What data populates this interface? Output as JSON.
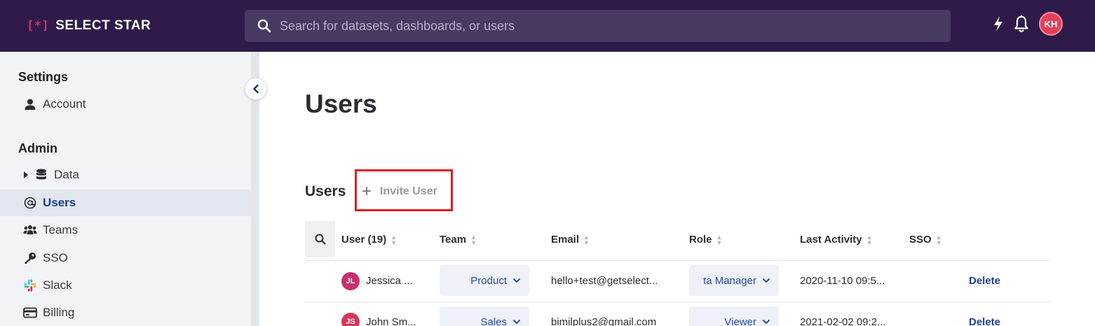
{
  "brand": {
    "name": "SELECT STAR",
    "mark": "[*]",
    "accent": "#e02a74",
    "bar_color": "#2e1b49"
  },
  "search": {
    "placeholder": "Search for datasets, dashboards, or users"
  },
  "header": {
    "user_initials": "KH",
    "icons": [
      "lightning-icon",
      "bell-icon"
    ]
  },
  "sidebar": {
    "settings_heading": "Settings",
    "admin_heading": "Admin",
    "items": [
      {
        "label": "Account",
        "icon": "user-icon"
      },
      {
        "label": "Data",
        "icon": "database-icon"
      },
      {
        "label": "Users",
        "icon": "at-icon",
        "active": true
      },
      {
        "label": "Teams",
        "icon": "team-icon"
      },
      {
        "label": "SSO",
        "icon": "key-icon"
      },
      {
        "label": "Slack",
        "icon": "slack-icon"
      },
      {
        "label": "Billing",
        "icon": "card-icon"
      }
    ]
  },
  "main": {
    "page_title": "Users",
    "section_title": "Users",
    "invite_plus": "+",
    "invite_label": "Invite User"
  },
  "table": {
    "columns": [
      "User (19)",
      "Team",
      "Email",
      "Role",
      "Last Activity",
      "SSO"
    ],
    "rows": [
      {
        "initials": "JL",
        "avatar_color": "#c9306a",
        "user": "Jessica ...",
        "team": "Product",
        "email": "hello+test@getselect...",
        "role": "ta Manager",
        "last_activity": "2020-11-10 09:5...",
        "sso": "",
        "action": "Delete"
      },
      {
        "initials": "JS",
        "avatar_color": "#d6365a",
        "user": "John Sm...",
        "team": "Sales",
        "email": "bimilplus2@gmail.com",
        "role": "Viewer",
        "last_activity": "2021-02-02 09:2...",
        "sso": "",
        "action": "Delete"
      }
    ]
  }
}
